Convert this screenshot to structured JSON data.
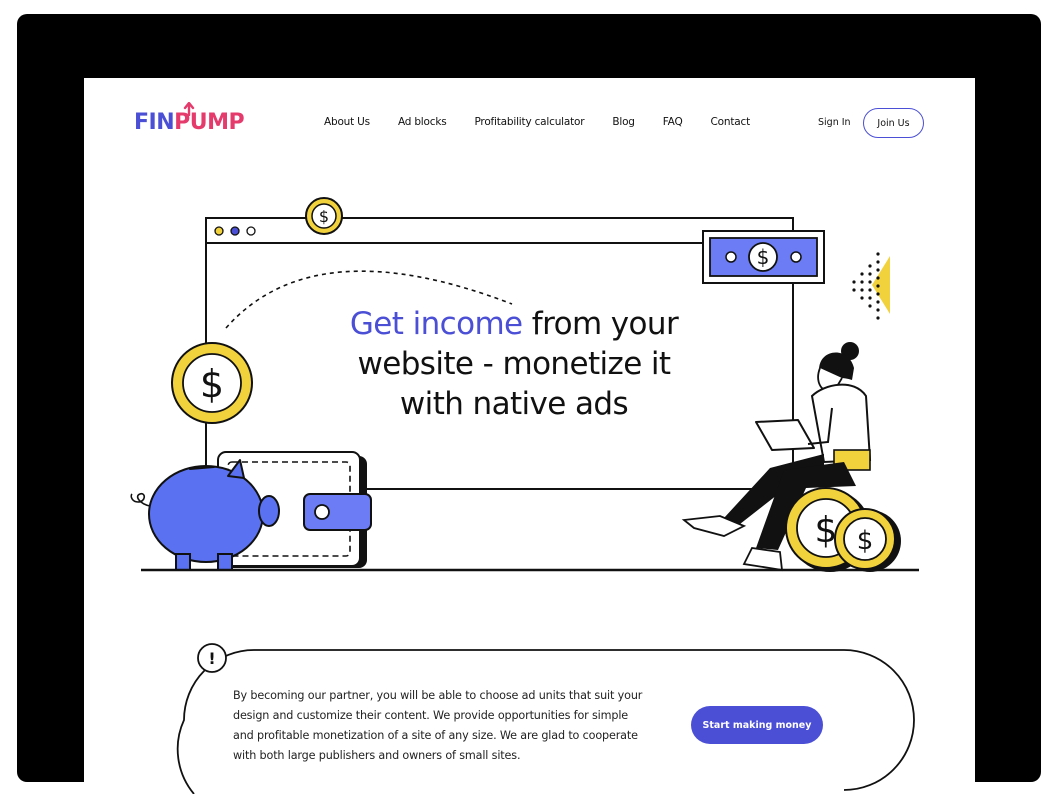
{
  "brand": {
    "logo_part_a": "FIN",
    "logo_part_b": "PUMP",
    "primary_color": "#4b4fd6",
    "accent_color": "#e53a6c",
    "highlight_color": "#f2d23c"
  },
  "nav": {
    "items": [
      "About Us",
      "Ad blocks",
      "Profitability calculator",
      "Blog",
      "FAQ",
      "Contact"
    ]
  },
  "auth": {
    "sign_in": "Sign In",
    "join": "Join Us"
  },
  "hero": {
    "headline_accent": "Get income",
    "headline_rest_1": "from your",
    "headline_line_2": "website - monetize it",
    "headline_line_3": "with native ads",
    "coin_symbol": "$"
  },
  "info": {
    "badge": "!",
    "text": "By becoming our partner, you will be able to choose ad units that suit your design and customize their content. We provide opportunities for simple and profitable monetization of a site of any size. We are glad to cooperate with both large publishers and owners of small sites.",
    "cta": "Start making money"
  }
}
